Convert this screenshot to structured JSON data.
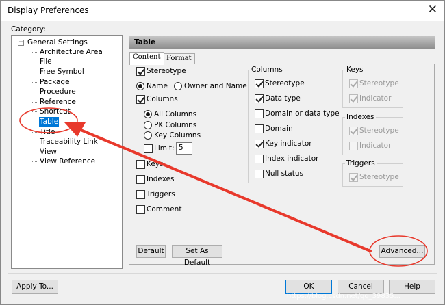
{
  "window": {
    "title": "Display Preferences"
  },
  "category": {
    "label": "Category:",
    "root": "General Settings",
    "items": [
      "Architecture Area",
      "File",
      "Free Symbol",
      "Package",
      "Procedure",
      "Reference",
      "Shortcut",
      "Table",
      "Title",
      "Traceability Link",
      "View",
      "View Reference"
    ],
    "selected": "Table"
  },
  "panel": {
    "header": "Table",
    "tabs": [
      "Content",
      "Format"
    ],
    "active_tab": "Content"
  },
  "content": {
    "stereotype": {
      "label": "Stereotype",
      "checked": true
    },
    "name_radio": {
      "label": "Name",
      "selected": true
    },
    "owner_name_radio": {
      "label": "Owner and Name",
      "selected": false
    },
    "columns": {
      "label": "Columns",
      "checked": true
    },
    "all_columns": {
      "label": "All Columns",
      "selected": true
    },
    "pk_columns": {
      "label": "PK Columns",
      "selected": false
    },
    "key_columns": {
      "label": "Key Columns",
      "selected": false
    },
    "limit": {
      "label": "Limit:",
      "checked": false,
      "value": "5"
    },
    "keys": {
      "label": "Keys",
      "checked": false
    },
    "indexes": {
      "label": "Indexes",
      "checked": false
    },
    "triggers": {
      "label": "Triggers",
      "checked": false
    },
    "comment": {
      "label": "Comment",
      "checked": false
    }
  },
  "columns_group": {
    "title": "Columns",
    "items": [
      {
        "label": "Stereotype",
        "checked": true
      },
      {
        "label": "Data type",
        "checked": true
      },
      {
        "label": "Domain or data type",
        "checked": false
      },
      {
        "label": "Domain",
        "checked": false
      },
      {
        "label": "Key indicator",
        "checked": true
      },
      {
        "label": "Index indicator",
        "checked": false
      },
      {
        "label": "Null status",
        "checked": false
      }
    ]
  },
  "keys_group": {
    "title": "Keys",
    "items": [
      {
        "label": "Stereotype",
        "checked": true
      },
      {
        "label": "Indicator",
        "checked": true
      }
    ]
  },
  "indexes_group": {
    "title": "Indexes",
    "items": [
      {
        "label": "Stereotype",
        "checked": true
      },
      {
        "label": "Indicator",
        "checked": false
      }
    ]
  },
  "triggers_group": {
    "title": "Triggers",
    "items": [
      {
        "label": "Stereotype",
        "checked": true
      }
    ]
  },
  "buttons": {
    "default": "Default",
    "set_as_default": "Set As Default",
    "advanced": "Advanced...",
    "apply_to": "Apply To...",
    "ok": "OK",
    "cancel": "Cancel",
    "help": "Help"
  },
  "watermark": "https://blog.csdn.net/qq_39835...",
  "annotation_color": "#e8392c"
}
